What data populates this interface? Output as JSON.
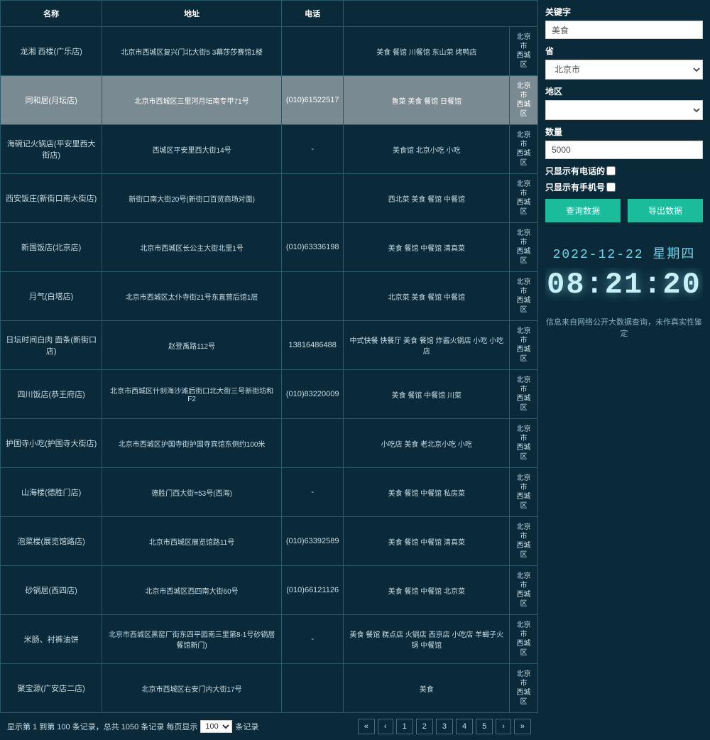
{
  "table": {
    "headers": [
      "名称",
      "地址",
      "电话",
      ""
    ],
    "rows": [
      {
        "name": "龙湘 西楼(广乐店)",
        "addr": "北京市西城区复兴门北大街5 3幕莎莎赛馆1楼",
        "phone": "",
        "cat": "美食 餐馆 川餐馆 东山荣 烤鸭店",
        "loc": "北京市\n西城区",
        "hl": false
      },
      {
        "name": "同和居(月坛店)",
        "addr": "北京市西城区三里河月坛南专甲71号",
        "phone": "(010)61522517",
        "cat": "鲁菜 美食 餐馆 日餐馆",
        "loc": "北京市\n西城区",
        "hl": true
      },
      {
        "name": "海碗记火锅店(平安里西大街店)",
        "addr": "西城区平安里西大街14号",
        "phone": "-",
        "cat": "美食馆 北京小吃 小吃",
        "loc": "北京市\n西城区",
        "hl": false
      },
      {
        "name": "西安饭庄(新街口南大街店)",
        "addr": "新街口南大街20号(新街口百货商场对面)",
        "phone": "",
        "cat": "西北菜 美食 餐馆 中餐馆",
        "loc": "北京市\n西城区",
        "hl": false
      },
      {
        "name": "新国饭店(北京店)",
        "addr": "北京市西城区长公主大街北里1号",
        "phone": "(010)63336198",
        "cat": "美食 餐馆 中餐馆 清真菜",
        "loc": "北京市\n西城区",
        "hl": false
      },
      {
        "name": "月气(白塔店)",
        "addr": "北京市西城区太仆寺街21号东直营后馆1层",
        "phone": "",
        "cat": "北京菜 美食 餐馆 中餐馆",
        "loc": "北京市\n西城区",
        "hl": false
      },
      {
        "name": "日坛时间白肉 面条(新街口店)",
        "addr": "赵登禹路112号",
        "phone": "13816486488",
        "cat": "中式快餐 快餐厅 美食 餐馆 炸酱火锅店 小吃 小吃店",
        "loc": "北京市\n西城区",
        "hl": false
      },
      {
        "name": "四川饭店(恭王府店)",
        "addr": "北京市西城区什刹海沙滩后街口北大街三号新街坊和F2",
        "phone": "(010)83220009",
        "cat": "美食 餐馆 中餐馆 川菜",
        "loc": "北京市\n西城区",
        "hl": false
      },
      {
        "name": "护国寺小吃(护国寺大街店)",
        "addr": "北京市西城区护国寺街护国寺宾馆东侧约100米",
        "phone": "",
        "cat": "小吃店 美食 老北京小吃 小吃",
        "loc": "北京市\n西城区",
        "hl": false
      },
      {
        "name": "山海楼(德胜门店)",
        "addr": "德胜门西大街=53号(西海)",
        "phone": "-",
        "cat": "美食 餐馆 中餐馆 私房菜",
        "loc": "北京市\n西城区",
        "hl": false
      },
      {
        "name": "泡菜楼(展览馆路店)",
        "addr": "北京市西城区展览馆路11号",
        "phone": "(010)63392589",
        "cat": "美食 餐馆 中餐馆 清真菜",
        "loc": "北京市\n西城区",
        "hl": false
      },
      {
        "name": "砂锅居(西四店)",
        "addr": "北京市西城区西四南大街60号",
        "phone": "(010)66121126",
        "cat": "美食 餐馆 中餐馆 北京菜",
        "loc": "北京市\n西城区",
        "hl": false
      },
      {
        "name": "米肠、衬裤油饼",
        "addr": "北京市西城区黑窑厂街东四平园南三里第8-1号砂锅居 餐馆新门)",
        "phone": "-",
        "cat": "美食 餐馆 糕点店 火锅店 西京店 小吃店 羊蝎子火锅 中餐馆",
        "loc": "北京市\n西城区",
        "hl": false
      },
      {
        "name": "聚宝源(广安店二店)",
        "addr": "北京市西城区右安门内大街17号",
        "phone": "",
        "cat": "美食",
        "loc": "北京市\n西城区",
        "hl": false
      }
    ]
  },
  "footer": {
    "info_pre": "显示第 1 到第 100 条记录，总共 1050 条记录 每页显示",
    "info_post": "条记录",
    "page_size": "100",
    "pages": [
      "«",
      "‹",
      "1",
      "2",
      "3",
      "4",
      "5",
      "›",
      "»"
    ]
  },
  "form": {
    "keyword_label": "关键字",
    "keyword_value": "美食",
    "province_label": "省",
    "province_value": "北京市",
    "region_label": "地区",
    "region_value": "",
    "count_label": "数量",
    "count_value": "5000",
    "chk_phone_label": "只显示有电话的",
    "chk_mobile_label": "只显示有手机号",
    "btn_query": "查询数据",
    "btn_export": "导出数据"
  },
  "clock": {
    "date": "2022-12-22 星期四",
    "time": "08:21:20"
  },
  "disclaimer": "信息来自网络公开大数据查询，未作真实性鉴定"
}
